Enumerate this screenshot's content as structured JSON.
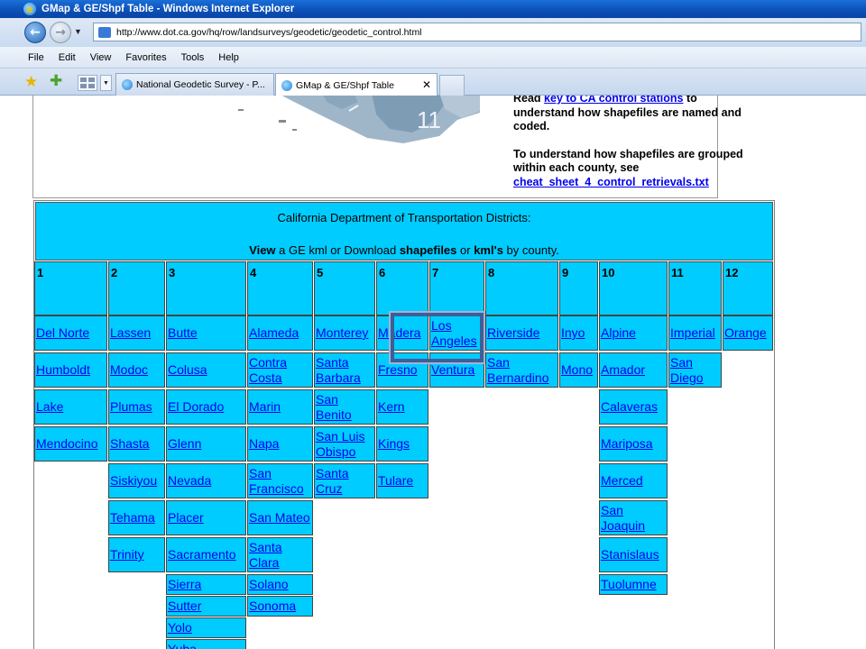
{
  "window": {
    "title": "GMap & GE/Shpf Table - Windows Internet Explorer"
  },
  "address_bar": {
    "url": "http://www.dot.ca.gov/hq/row/landsurveys/geodetic/geodetic_control.html"
  },
  "menu": [
    "File",
    "Edit",
    "View",
    "Favorites",
    "Tools",
    "Help"
  ],
  "tabs": [
    {
      "label": "National Geodetic Survey - P...",
      "active": false
    },
    {
      "label": "GMap & GE/Shpf Table",
      "active": true
    }
  ],
  "map": {
    "region_label": "11"
  },
  "info": {
    "p1_read": "Read ",
    "p1_link": "key to CA control stations",
    "p1_rest": " to understand how shapefiles are named and coded.",
    "p2_text": "To understand how shapefiles are grouped within each county, see ",
    "p2_link": "cheat_sheet_4_control_retrievals.txt"
  },
  "districts_table": {
    "title": "California Department of Transportation Districts:",
    "view_word": "View",
    "mid1": " a GE kml or Download ",
    "shapefiles_word": "shapefiles",
    "mid2": " or ",
    "kml_word": "kml's",
    "end": " by county.",
    "numbers": [
      "1",
      "2",
      "3",
      "4",
      "5",
      "6",
      "7",
      "8",
      "9",
      "10",
      "11",
      "12"
    ],
    "columns": [
      [
        "Del Norte",
        "Humboldt",
        "Lake",
        "Mendocino"
      ],
      [
        "Lassen",
        "Modoc",
        "Plumas",
        "Shasta",
        "Siskiyou",
        "Tehama",
        "Trinity"
      ],
      [
        "Butte",
        "Colusa",
        "El Dorado",
        "Glenn",
        "Nevada",
        "Placer",
        "Sacramento",
        "Sierra",
        "Sutter",
        "Yolo",
        "Yuba"
      ],
      [
        "Alameda",
        "Contra Costa",
        "Marin",
        "Napa",
        "San Francisco",
        "San Mateo",
        "Santa Clara",
        "Solano",
        "Sonoma"
      ],
      [
        "Monterey",
        "Santa Barbara",
        "San Benito",
        "San Luis Obispo",
        "Santa Cruz"
      ],
      [
        "Madera",
        "Fresno",
        "Kern",
        "Kings",
        "Tulare"
      ],
      [
        "Los Angeles",
        "Ventura"
      ],
      [
        "Riverside",
        "San Bernardino"
      ],
      [
        "Inyo",
        "Mono"
      ],
      [
        "Alpine",
        "Amador",
        "Calaveras",
        "Mariposa",
        "Merced",
        "San Joaquin",
        "Stanislaus",
        "Tuolumne"
      ],
      [
        "Imperial",
        "San Diego"
      ],
      [
        "Orange"
      ]
    ]
  }
}
